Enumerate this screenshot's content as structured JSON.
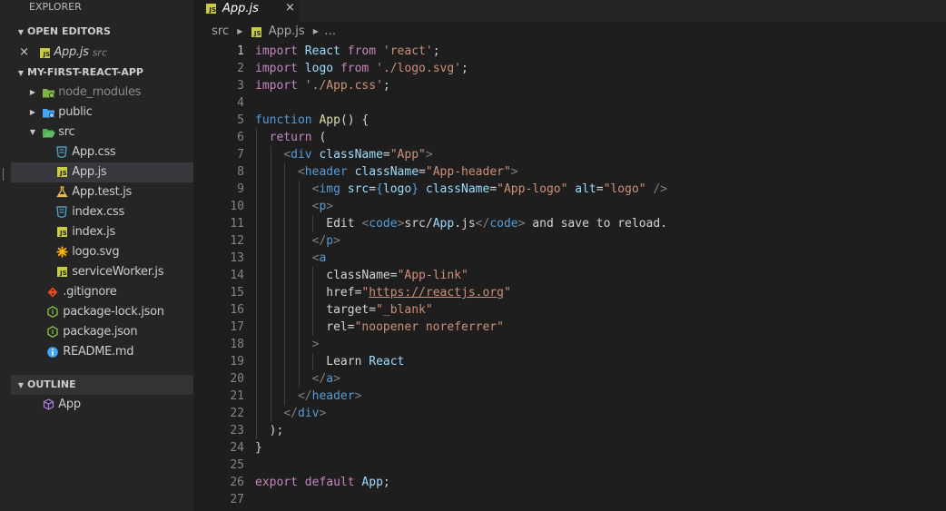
{
  "sidebar": {
    "title": "EXPLORER",
    "open_editors": {
      "header": "OPEN EDITORS",
      "items": [
        {
          "close": "×",
          "name": "App.js",
          "folder": "src"
        }
      ]
    },
    "project": {
      "header": "MY-FIRST-REACT-APP",
      "items": [
        {
          "label": "node_modules",
          "kind": "folder"
        },
        {
          "label": "public",
          "kind": "folder"
        },
        {
          "label": "src",
          "kind": "folder-open"
        },
        {
          "label": "App.css",
          "kind": "css"
        },
        {
          "label": "App.js",
          "kind": "js"
        },
        {
          "label": "App.test.js",
          "kind": "test"
        },
        {
          "label": "index.css",
          "kind": "css"
        },
        {
          "label": "index.js",
          "kind": "js"
        },
        {
          "label": "logo.svg",
          "kind": "svg"
        },
        {
          "label": "serviceWorker.js",
          "kind": "js"
        },
        {
          "label": ".gitignore",
          "kind": "git"
        },
        {
          "label": "package-lock.json",
          "kind": "node"
        },
        {
          "label": "package.json",
          "kind": "node"
        },
        {
          "label": "README.md",
          "kind": "info"
        }
      ]
    },
    "outline": {
      "header": "OUTLINE",
      "items": [
        {
          "label": "App"
        }
      ]
    }
  },
  "tab": {
    "label": "App.js",
    "close": "×",
    "icon": "JS"
  },
  "breadcrumb": {
    "folder": "src",
    "file": "App.js",
    "more": "…"
  },
  "editor": {
    "line_numbers": [
      "1",
      "2",
      "3",
      "4",
      "5",
      "6",
      "7",
      "8",
      "9",
      "10",
      "11",
      "12",
      "13",
      "14",
      "15",
      "16",
      "17",
      "18",
      "19",
      "20",
      "21",
      "22",
      "23",
      "24",
      "25",
      "26",
      "27"
    ],
    "current_line": "1",
    "lines": [
      "import React from 'react';",
      "import logo from './logo.svg';",
      "import './App.css';",
      "",
      "function App() {",
      "  return (",
      "    <div className=\"App\">",
      "      <header className=\"App-header\">",
      "        <img src={logo} className=\"App-logo\" alt=\"logo\" />",
      "        <p>",
      "          Edit <code>src/App.js</code> and save to reload.",
      "        </p>",
      "        <a",
      "          className=\"App-link\"",
      "          href=\"https://reactjs.org\"",
      "          target=\"_blank\"",
      "          rel=\"noopener noreferrer\"",
      "        >",
      "          Learn React",
      "        </a>",
      "      </header>",
      "    </div>",
      "  );",
      "}",
      "",
      "export default App;",
      ""
    ]
  },
  "colors": {
    "keyword": "#569cd6",
    "control": "#c586c0",
    "string": "#ce9178",
    "function": "#dcdcaa",
    "variable": "#9cdcfe",
    "js_icon": "#cbcb41",
    "css_icon": "#519aba",
    "node_icon": "#8bc34a",
    "git_icon": "#e64a19"
  }
}
